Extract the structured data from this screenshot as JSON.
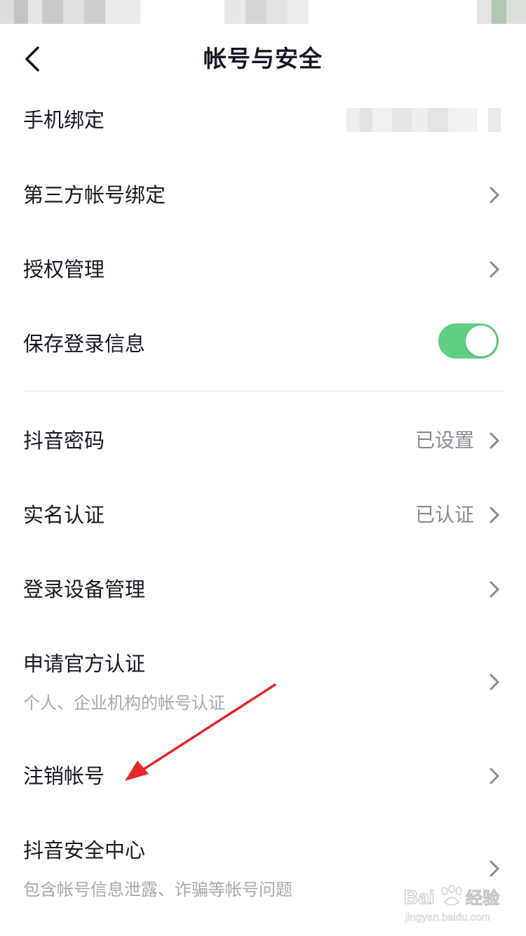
{
  "header": {
    "title": "帐号与安全"
  },
  "rows": {
    "phone_binding": {
      "label": "手机绑定"
    },
    "third_party": {
      "label": "第三方帐号绑定"
    },
    "authorization": {
      "label": "授权管理"
    },
    "save_login": {
      "label": "保存登录信息",
      "enabled": true
    },
    "douyin_password": {
      "label": "抖音密码",
      "value": "已设置"
    },
    "real_name": {
      "label": "实名认证",
      "value": "已认证"
    },
    "device_mgmt": {
      "label": "登录设备管理"
    },
    "official_cert": {
      "label": "申请官方认证",
      "sub": "个人、企业机构的帐号认证"
    },
    "cancel_account": {
      "label": "注销帐号"
    },
    "security_center": {
      "label": "抖音安全中心",
      "sub": "包含帐号信息泄露、诈骗等帐号问题"
    }
  },
  "watermark": {
    "brand": "Bai",
    "brand_cn": "经验",
    "url": "jingyan.baidu.com"
  },
  "colors": {
    "toggle_on": "#5fcf84",
    "annotation": "#e8262a",
    "text_primary": "#161823",
    "text_secondary": "#8a8b91"
  }
}
